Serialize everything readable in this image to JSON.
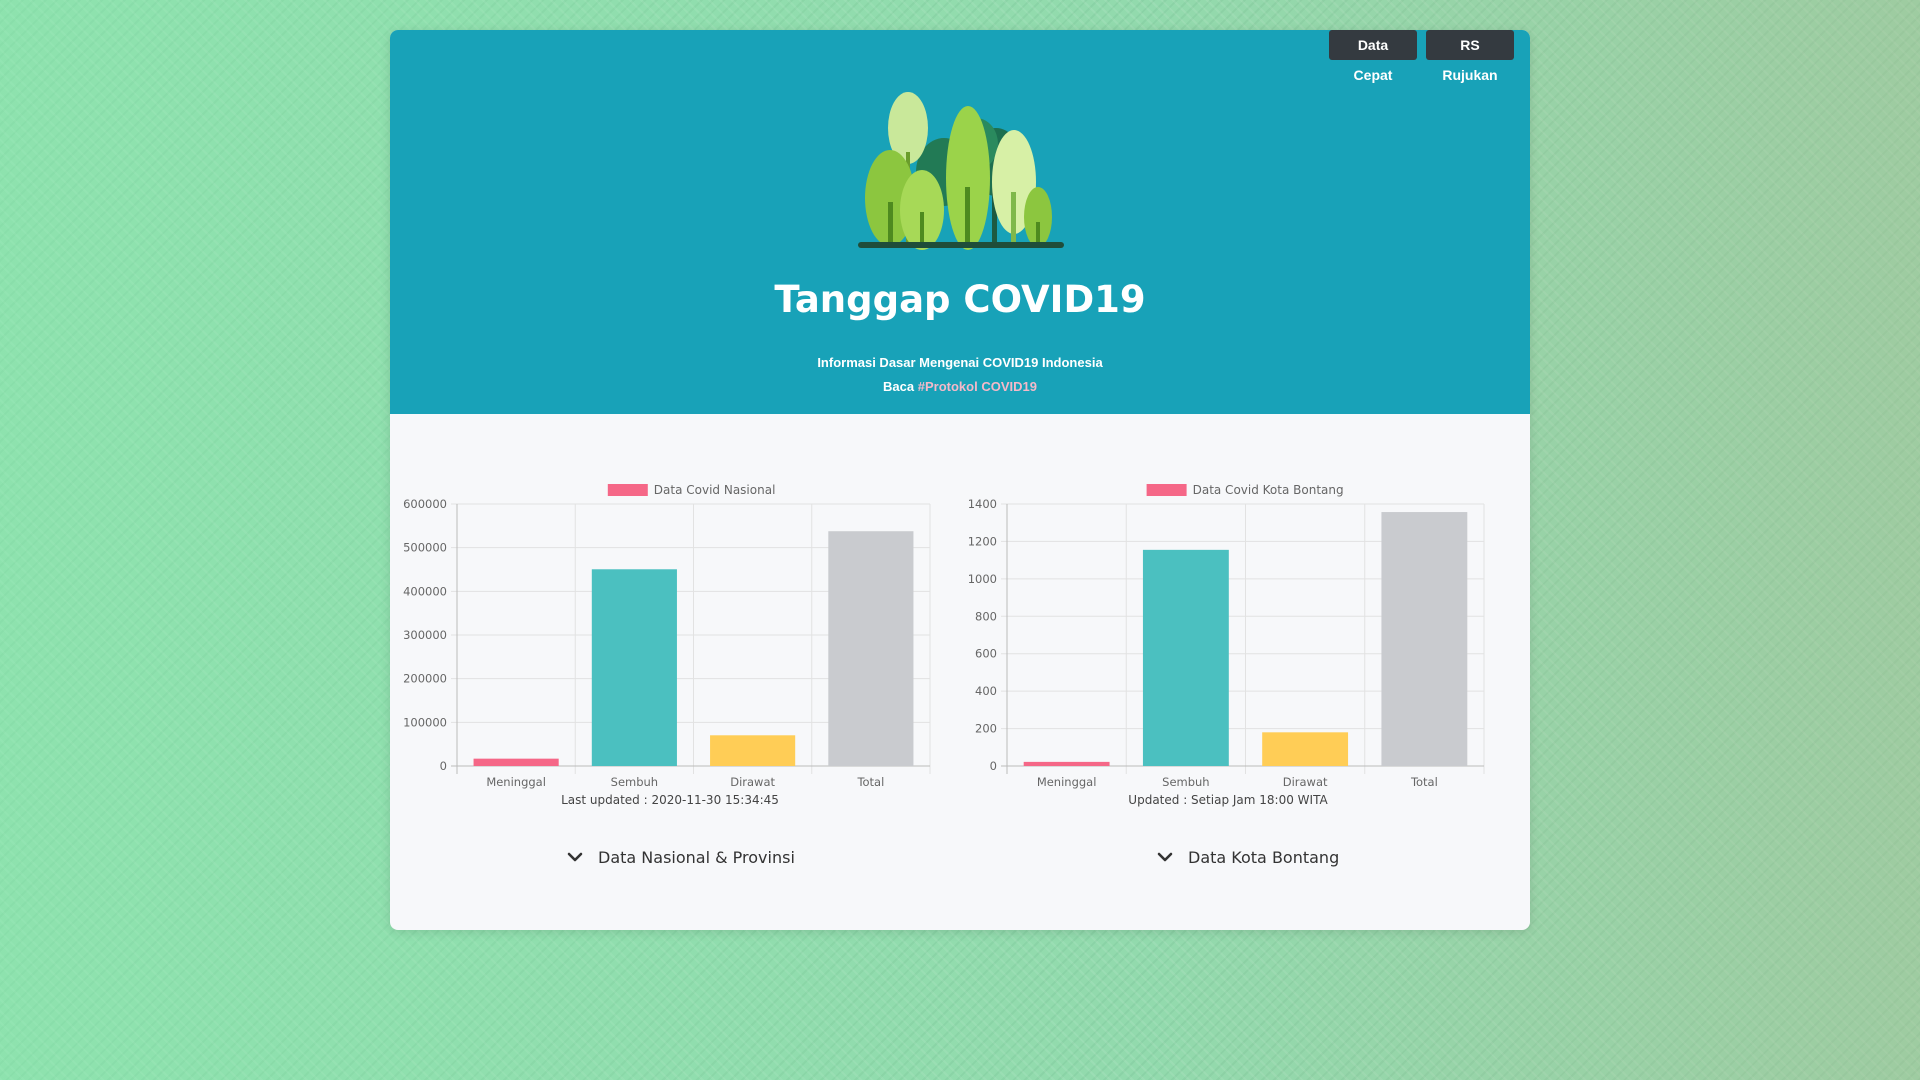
{
  "nav": {
    "data_cepat": "Data Cepat",
    "rs_rujukan": "RS Rujukan"
  },
  "header": {
    "title": "Tanggap COVID19",
    "subtitle": "Informasi Dasar Mengenai COVID19 Indonesia",
    "baca_prefix": "Baca",
    "baca_link": "#Protokol COVID19"
  },
  "chart_data": [
    {
      "type": "bar",
      "legend": "Data Covid Nasional",
      "categories": [
        "Meninggal",
        "Sembuh",
        "Dirawat",
        "Total"
      ],
      "values": [
        16815,
        450518,
        70328,
        537655
      ],
      "colors": [
        "#f56787",
        "#4bc0c0",
        "#ffcd56",
        "#c9cbcf"
      ],
      "ylim": [
        0,
        600000
      ],
      "yticks": [
        0,
        100000,
        200000,
        300000,
        400000,
        500000,
        600000
      ],
      "grid": true,
      "legend_position": "top"
    },
    {
      "type": "bar",
      "legend": "Data Covid Kota Bontang",
      "categories": [
        "Meninggal",
        "Sembuh",
        "Dirawat",
        "Total"
      ],
      "values": [
        22,
        1155,
        180,
        1357
      ],
      "colors": [
        "#f56787",
        "#4bc0c0",
        "#ffcd56",
        "#c9cbcf"
      ],
      "ylim": [
        0,
        1400
      ],
      "yticks": [
        0,
        200,
        400,
        600,
        800,
        1000,
        1200,
        1400
      ],
      "grid": true,
      "legend_position": "top"
    }
  ],
  "updates": {
    "nasional": "Last updated : 2020-11-30 15:34:45",
    "bontang": "Updated : Setiap Jam 18:00 WITA"
  },
  "sections": {
    "nasional": "Data Nasional & Provinsi",
    "bontang": "Data Kota Bontang"
  },
  "icons": {
    "collapse": "chevron-down-icon",
    "logo": "trees-logo"
  },
  "colors": {
    "header": "#18a2b8",
    "button": "#343a40",
    "link": "#f6b9c9"
  }
}
